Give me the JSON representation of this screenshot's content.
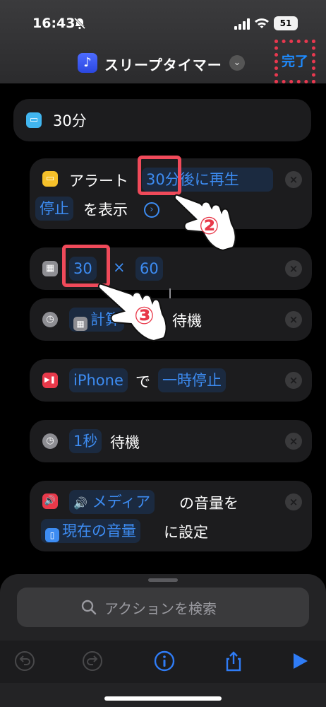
{
  "status_bar": {
    "time": "16:43",
    "battery": "51"
  },
  "nav": {
    "app_icon": "music-note-icon",
    "title": "スリープタイマー",
    "done_label": "完了"
  },
  "actions": {
    "number": {
      "value": "30分"
    },
    "alert": {
      "label": "アラート",
      "message": "30分後に再生停止",
      "message_part1": "30分後に再生",
      "message_part2": "停止",
      "suffix": "を表示"
    },
    "calc": {
      "left": "30",
      "operator": "×",
      "right": "60"
    },
    "wait_calc": {
      "token": "計算",
      "suffix": "待機"
    },
    "pause": {
      "device": "iPhone",
      "particle": "で",
      "action": "一時停止"
    },
    "wait_1s": {
      "duration": "1秒",
      "suffix": "待機"
    },
    "volume": {
      "media": "メディア",
      "middle": "の音量を",
      "current": "現在の音量",
      "suffix": "に設定"
    }
  },
  "annotations": {
    "step2": "②",
    "step3": "③"
  },
  "search": {
    "placeholder": "アクションを検索"
  },
  "colors": {
    "accent": "#3d8cf2",
    "highlight": "#f04a5a",
    "card": "#1c1c1e"
  }
}
